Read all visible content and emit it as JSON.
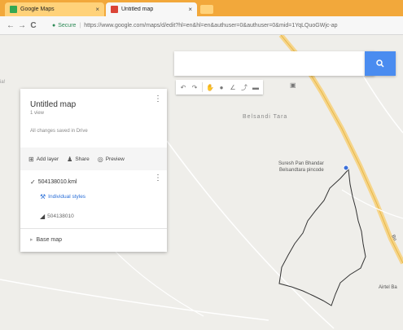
{
  "browser": {
    "tabs": [
      {
        "label": "Google Maps",
        "close": "×",
        "favicon_color": "#34a853"
      },
      {
        "label": "Untitled map",
        "close": "×",
        "favicon_color": "#db4437"
      }
    ],
    "nav": {
      "back": "←",
      "forward": "→",
      "reload": "C"
    },
    "address": {
      "secure_label": "Secure",
      "url": "https://www.google.com/maps/d/edit?hl=en&hl=en&authuser=0&authuser=0&mid=1YqLQuoGWjc-ap"
    }
  },
  "map": {
    "search": {
      "placeholder": "",
      "value": ""
    },
    "place_labels": {
      "village": "Belsandi Tara"
    },
    "poi": {
      "line1": "Suresh Pan Bhandar",
      "line2": "Belsandtara pincode"
    },
    "edge_label": "Airtel Ba",
    "route_label": "Bu",
    "side_glyph": "ia!"
  },
  "panel": {
    "title": "Untitled map",
    "views": "1 view",
    "status": "All changes saved in Drive",
    "actions": {
      "add_layer": "Add layer",
      "share": "Share",
      "preview": "Preview"
    },
    "layer": {
      "name": "504138010.kml",
      "styles": "Individual styles",
      "feature": "504138010"
    },
    "base_map": "Base map"
  },
  "colors": {
    "tabbar": "#f2a83b",
    "search_button": "#4a8cf0",
    "link": "#2a6fd8",
    "major_road": "#f6d58a"
  }
}
